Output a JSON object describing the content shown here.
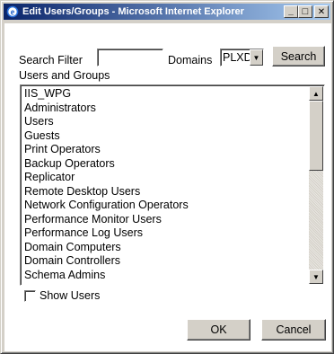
{
  "window": {
    "title": "Edit Users/Groups - Microsoft Internet Explorer",
    "minimize": "_",
    "maximize": "□",
    "close": "✕"
  },
  "filter": {
    "search_label": "Search Filter",
    "search_value": "",
    "domains_label": "Domains",
    "domain_value": "PLXD",
    "search_button": "Search"
  },
  "list": {
    "label": "Users and Groups",
    "items": [
      "IIS_WPG",
      "Administrators",
      "Users",
      "Guests",
      "Print Operators",
      "Backup Operators",
      "Replicator",
      "Remote Desktop Users",
      "Network Configuration Operators",
      "Performance Monitor Users",
      "Performance Log Users",
      "Domain Computers",
      "Domain Controllers",
      "Schema Admins"
    ]
  },
  "options": {
    "show_users_label": "Show Users",
    "show_users_checked": false
  },
  "actions": {
    "ok": "OK",
    "cancel": "Cancel"
  },
  "icons": {
    "title": "ie-icon",
    "scroll_up": "arrow-up-icon",
    "scroll_down": "arrow-down-icon",
    "dropdown": "chevron-down-icon"
  }
}
